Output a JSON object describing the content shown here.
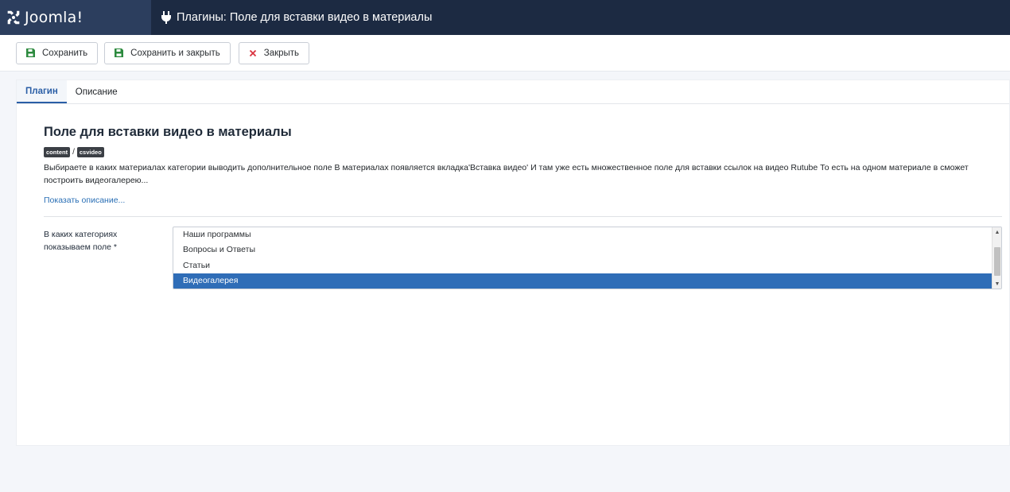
{
  "header": {
    "brand": "Joomla!",
    "title": "Плагины: Поле для вставки видео в материалы"
  },
  "toolbar": {
    "save_label": "Сохранить",
    "save_close_label": "Сохранить и закрыть",
    "close_label": "Закрыть"
  },
  "tabs": [
    {
      "label": "Плагин",
      "active": true
    },
    {
      "label": "Описание",
      "active": false
    }
  ],
  "plugin": {
    "title": "Поле для вставки видео в материалы",
    "tags": [
      "content",
      "csvideo"
    ],
    "tag_separator": "/",
    "description": "Выбираете в каких материалах категории выводить дополнительное поле В материалах появляется вкладка'Вставка видео' И там уже есть множественное поле для вставки ссылок на видео Rutube То есть на одном материале в сможет построить видеогалерею...",
    "show_description": "Показать описание..."
  },
  "field": {
    "label": "В каких категориях показываем поле *",
    "options": [
      {
        "label": "Наши программы",
        "selected": false
      },
      {
        "label": "Вопросы и Ответы",
        "selected": false
      },
      {
        "label": "Статьи",
        "selected": false
      },
      {
        "label": "Видеогалерея",
        "selected": true
      }
    ]
  },
  "colors": {
    "header_bg": "#1c2a42",
    "brand_bg": "#2c3e5e",
    "accent": "#2a5ea6",
    "selected_bg": "#2f6db7",
    "save_icon": "#2c8a3e",
    "close_icon": "#d9333f"
  },
  "icons": {
    "brand": "joomla-logo",
    "title": "plug-icon",
    "save": "floppy-disk-icon",
    "save_close": "floppy-disk-icon",
    "close": "x-icon"
  }
}
